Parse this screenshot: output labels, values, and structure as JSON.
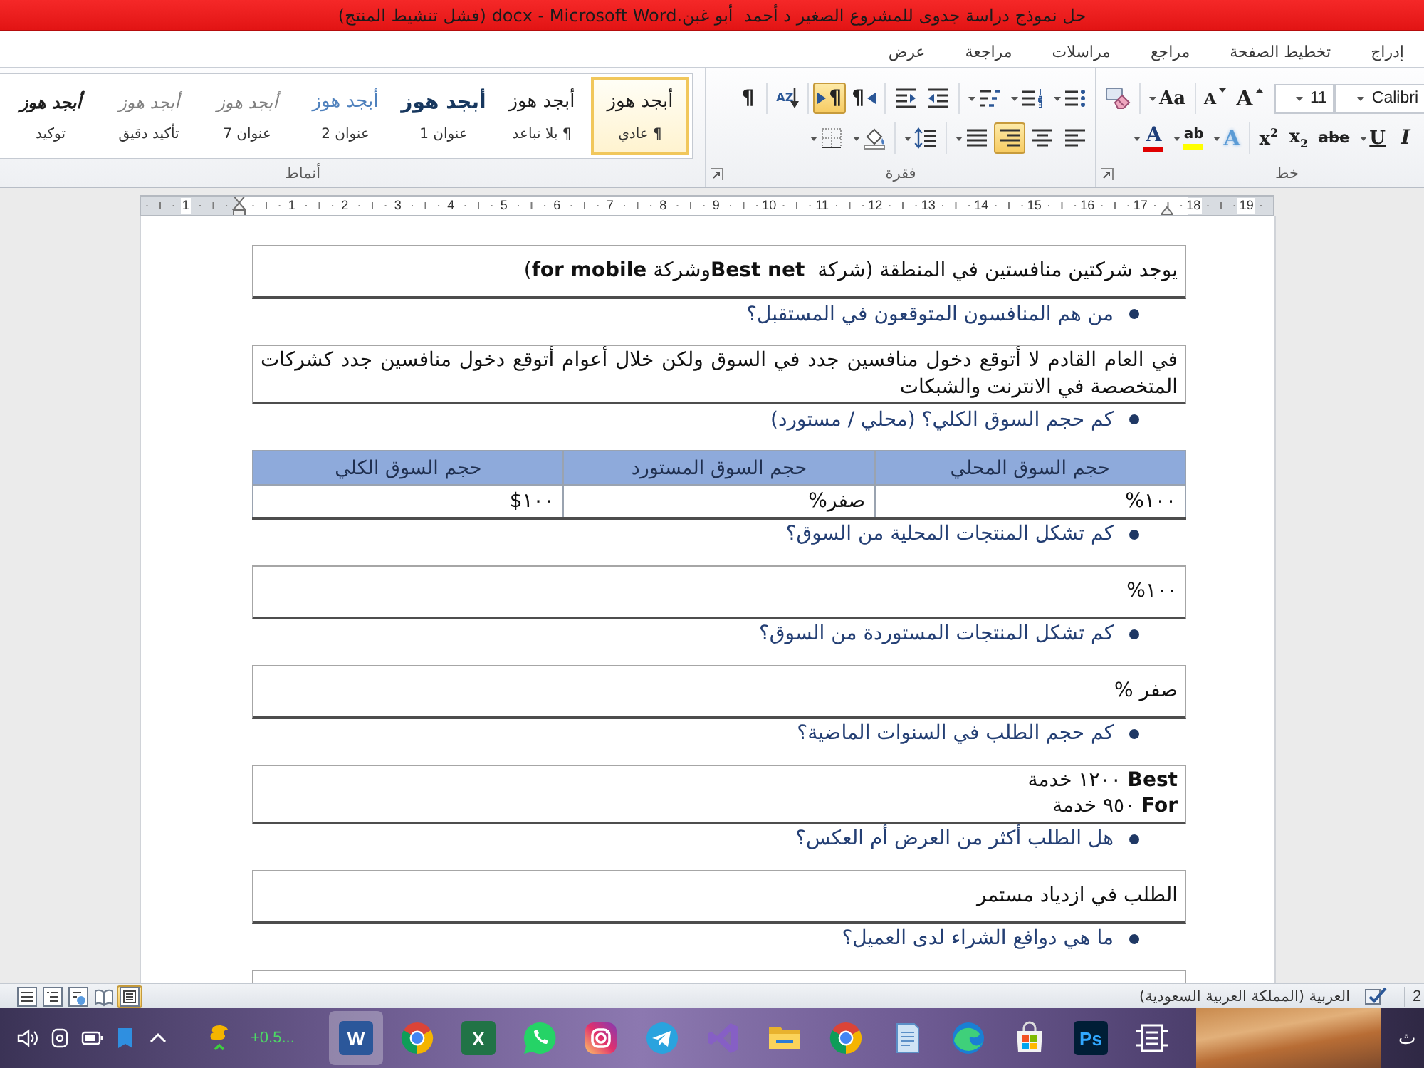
{
  "window": {
    "title": "حل نموذج دراسة جدوى للمشروع الصغير د أحمد  أبو غبن.docx - Microsoft Word (فشل تنشيط المنتج)"
  },
  "ribbon_tabs": [
    {
      "label": "إدراج",
      "selected": false
    },
    {
      "label": "تخطيط الصفحة",
      "selected": false
    },
    {
      "label": "مراجع",
      "selected": false
    },
    {
      "label": "مراسلات",
      "selected": false
    },
    {
      "label": "مراجعة",
      "selected": false
    },
    {
      "label": "عرض",
      "selected": false
    }
  ],
  "ribbon": {
    "groups": [
      {
        "kind": "font",
        "label": "خط",
        "top_row": {
          "fields": [
            {
              "kind": "font-name",
              "value": "Calibri"
            },
            {
              "kind": "font-size",
              "value": "11"
            }
          ],
          "clusters": [
            {
              "buttons": [
                {
                  "kind": "grow-font",
                  "glyph": "A",
                  "dropdown": false,
                  "selected": false
                },
                {
                  "kind": "shrink-font",
                  "glyph": "A",
                  "dropdown": false,
                  "selected": false
                }
              ]
            },
            {
              "buttons": [
                {
                  "kind": "change-case",
                  "glyph": "Aa",
                  "dropdown": true,
                  "selected": false
                }
              ]
            },
            {
              "buttons": [
                {
                  "kind": "clear-format",
                  "dropdown": false,
                  "selected": false
                }
              ]
            }
          ]
        },
        "bottom_row": {
          "clusters": [
            {
              "buttons": [
                {
                  "kind": "italic",
                  "glyph": "I",
                  "dropdown": false,
                  "selected": false
                },
                {
                  "kind": "underline",
                  "glyph": "U",
                  "dropdown": true,
                  "selected": false
                },
                {
                  "kind": "strikethrough",
                  "glyph": "abe",
                  "dropdown": false,
                  "selected": false
                },
                {
                  "kind": "subscript",
                  "glyph": "x$_{2}$",
                  "dropdown": false,
                  "selected": false
                },
                {
                  "kind": "superscript",
                  "glyph": "x$^{2}$",
                  "dropdown": false,
                  "selected": false
                }
              ]
            },
            {
              "buttons": [
                {
                  "kind": "text-effect",
                  "glyph": "A",
                  "dropdown": true,
                  "selected": false
                },
                {
                  "kind": "highlight",
                  "glyph": "ab",
                  "dropdown": true,
                  "selected": false
                },
                {
                  "kind": "font-color",
                  "glyph": "A",
                  "dropdown": true,
                  "selected": false
                }
              ]
            }
          ]
        }
      },
      {
        "kind": "paragraph",
        "label": "فقرة",
        "top_row": {
          "clusters": [
            {
              "buttons": [
                {
                  "kind": "bullets",
                  "dropdown": true,
                  "selected": false
                },
                {
                  "kind": "numbering",
                  "dropdown": true,
                  "selected": false
                },
                {
                  "kind": "multilevel",
                  "dropdown": true,
                  "selected": false
                }
              ]
            },
            {
              "buttons": [
                {
                  "kind": "outdent",
                  "dropdown": false,
                  "selected": false
                },
                {
                  "kind": "indent",
                  "dropdown": false,
                  "selected": false
                }
              ]
            },
            {
              "buttons": [
                {
                  "kind": "direction-rtl",
                  "glyph": "¶",
                  "dropdown": false,
                  "selected": false
                },
                {
                  "kind": "direction-ltr",
                  "glyph": "¶",
                  "dropdown": false,
                  "selected": true
                }
              ]
            },
            {
              "buttons": [
                {
                  "kind": "sort",
                  "glyph": "AZ",
                  "dropdown": false,
                  "selected": false
                }
              ]
            },
            {
              "buttons": [
                {
                  "kind": "marks",
                  "glyph": "¶",
                  "dropdown": false,
                  "selected": false
                }
              ]
            }
          ]
        },
        "bottom_row": {
          "clusters": [
            {
              "buttons": [
                {
                  "kind": "align-left",
                  "dropdown": false,
                  "selected": false
                },
                {
                  "kind": "align-center",
                  "dropdown": false,
                  "selected": false
                },
                {
                  "kind": "align-right",
                  "dropdown": false,
                  "selected": true
                },
                {
                  "kind": "justify",
                  "dropdown": true,
                  "selected": false
                }
              ]
            },
            {
              "buttons": [
                {
                  "kind": "line-spacing",
                  "dropdown": true,
                  "selected": false
                }
              ]
            },
            {
              "buttons": [
                {
                  "kind": "shading",
                  "dropdown": true,
                  "selected": false
                },
                {
                  "kind": "borders",
                  "dropdown": true,
                  "selected": false
                }
              ]
            }
          ]
        }
      },
      {
        "kind": "styles",
        "label": "أنماط",
        "styles": [
          {
            "preview": "أبجد هوز",
            "label": "¶ عادي",
            "kind": "plain",
            "selected": true
          },
          {
            "preview": "أبجد هوز",
            "label": "¶ بلا تباعد",
            "kind": "plain",
            "selected": false
          },
          {
            "preview": "أبجد هوز",
            "label": "عنوان 1",
            "kind": "heading",
            "selected": false
          },
          {
            "preview": "أبجد هوز",
            "label": "عنوان 2",
            "kind": "subheading",
            "selected": false
          },
          {
            "preview": "أبجد هوز",
            "label": "عنوان 7",
            "kind": "muted-italic",
            "selected": false
          },
          {
            "preview": "أبجد هوز",
            "label": "تأكيد دقيق",
            "kind": "muted-italic",
            "selected": false
          },
          {
            "preview": "أبجد هوز",
            "label": "توكيد",
            "kind": "italic",
            "selected": false
          }
        ]
      }
    ]
  },
  "ruler": {
    "labels": [
      "19",
      "18",
      "17",
      "16",
      "15",
      "14",
      "13",
      "12",
      "11",
      "10",
      "9",
      "8",
      "7",
      "6",
      "5",
      "4",
      "3",
      "2",
      "1",
      "1"
    ]
  },
  "document": {
    "blocks": [
      {
        "kind": "box",
        "text": "يوجد شركتين منافستين في المنطقة (شركة  **Best net**وشركة **for mobile**)"
      },
      {
        "kind": "bullet",
        "text": "من هم المنافسون المتوقعون في المستقبل؟"
      },
      {
        "kind": "box",
        "text": "في العام القادم لا أتوقع دخول منافسين جدد في السوق ولكن خلال أعوام أتوقع دخول منافسين جدد كشركات المتخصصة في الانترنت والشبكات"
      },
      {
        "kind": "bullet",
        "text": "كم حجم السوق الكلي؟ (محلي / مستورد)"
      },
      {
        "kind": "table",
        "columns": [
          "حجم السوق المحلي",
          "حجم السوق المستورد",
          "حجم السوق الكلي"
        ],
        "rows": [
          [
            "١٠٠%",
            "صفر%",
            "١٠٠$"
          ]
        ]
      },
      {
        "kind": "bullet",
        "text": "كم تشكل المنتجات المحلية من السوق؟"
      },
      {
        "kind": "box",
        "text": "١٠٠%"
      },
      {
        "kind": "bullet",
        "text": "كم تشكل المنتجات المستوردة من السوق؟"
      },
      {
        "kind": "box",
        "text": "صفر %"
      },
      {
        "kind": "bullet",
        "text": "كم حجم الطلب في السنوات الماضية؟"
      },
      {
        "kind": "box",
        "lines": [
          "**Best** ١٢٠٠ خدمة",
          "**For** ٩٥٠ خدمة"
        ]
      },
      {
        "kind": "bullet",
        "text": "هل الطلب أكثر من العرض أم العكس؟"
      },
      {
        "kind": "box",
        "text": "الطلب في ازدياد مستمر"
      },
      {
        "kind": "bullet",
        "text": "ما هي دوافع الشراء لدى العميل؟"
      },
      {
        "kind": "box"
      }
    ]
  },
  "status_bar": {
    "views": [
      {
        "kind": "draft",
        "selected": false
      },
      {
        "kind": "outline",
        "selected": false
      },
      {
        "kind": "web",
        "selected": false
      },
      {
        "kind": "reading",
        "selected": false
      },
      {
        "kind": "print",
        "selected": true
      }
    ],
    "language": "العربية (المملكة العربية السعودية)",
    "edge_text": "2"
  },
  "taskbar": {
    "tray": [
      {
        "kind": "speaker"
      },
      {
        "kind": "device"
      },
      {
        "kind": "battery"
      },
      {
        "kind": "bookmark"
      },
      {
        "kind": "chevron"
      }
    ],
    "widget_text": "+0.5...",
    "apps": [
      {
        "kind": "frame",
        "selected": false
      },
      {
        "kind": "letter-tile",
        "glyph": "Ps",
        "selected": false
      },
      {
        "kind": "bag-tile",
        "selected": false
      },
      {
        "kind": "swirl-logo",
        "selected": false
      },
      {
        "kind": "notepad",
        "selected": false
      },
      {
        "kind": "ring-logo",
        "selected": false
      },
      {
        "kind": "folder",
        "selected": false
      },
      {
        "kind": "ribbon-logo",
        "selected": false
      },
      {
        "kind": "plane-circle",
        "selected": false
      },
      {
        "kind": "camera-tile",
        "selected": false
      },
      {
        "kind": "phone-bubble",
        "selected": false
      },
      {
        "kind": "sheet-tile",
        "glyph": "X",
        "selected": false
      },
      {
        "kind": "ring-logo",
        "selected": false
      },
      {
        "kind": "doc-tile",
        "glyph": "W",
        "selected": true
      }
    ],
    "input_indicator": "ث"
  }
}
